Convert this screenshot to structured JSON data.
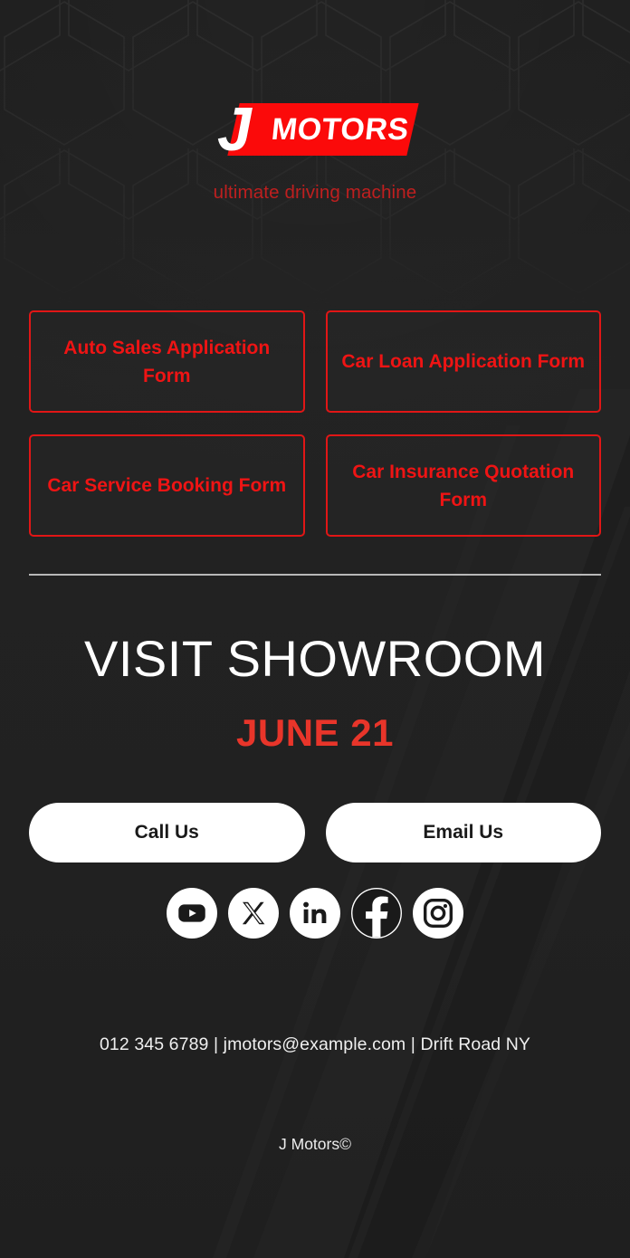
{
  "brand": {
    "logo_letter": "J",
    "logo_word": "MOTORS",
    "tagline": "ultimate driving machine",
    "accent_red": "#e11616",
    "bright_red": "#fb0a0a",
    "date_red": "#e8352a",
    "tagline_red": "#bf1f1f",
    "background": "#212121"
  },
  "forms": [
    {
      "label": "Auto Sales Application Form",
      "name": "auto-sales-application-form"
    },
    {
      "label": "Car Loan Application Form",
      "name": "car-loan-application-form"
    },
    {
      "label": "Car Service Booking Form",
      "name": "car-service-booking-form"
    },
    {
      "label": "Car Insurance Quotation Form",
      "name": "car-insurance-quotation-form"
    }
  ],
  "showroom": {
    "title": "VISIT SHOWROOM",
    "date": "JUNE 21"
  },
  "cta": {
    "call_label": "Call Us",
    "email_label": "Email Us"
  },
  "socials": [
    {
      "icon": "youtube-icon",
      "label": "YouTube"
    },
    {
      "icon": "x-twitter-icon",
      "label": "X"
    },
    {
      "icon": "linkedin-icon",
      "label": "LinkedIn"
    },
    {
      "icon": "facebook-icon",
      "label": "Facebook"
    },
    {
      "icon": "instagram-icon",
      "label": "Instagram"
    }
  ],
  "footer": {
    "phone": "012 345 6789",
    "email": "jmotors@example.com",
    "address": "Drift Road NY",
    "contact_line": "012 345 6789 | jmotors@example.com | Drift Road NY",
    "copyright": "J Motors©"
  }
}
